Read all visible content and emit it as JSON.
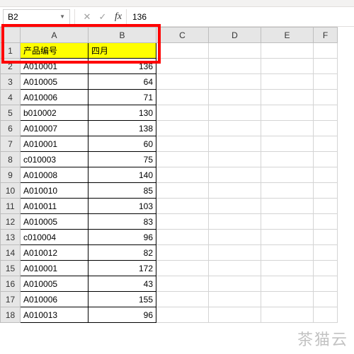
{
  "formula_bar": {
    "name_box": "B2",
    "formula_value": "136"
  },
  "columns": [
    "A",
    "B",
    "C",
    "D",
    "E",
    "F"
  ],
  "headers": {
    "A": "产品编号",
    "B": "四月"
  },
  "rows": [
    {
      "n": 1,
      "a": "产品编号",
      "b": "四月",
      "header": true
    },
    {
      "n": 2,
      "a": "A010001",
      "b": "136"
    },
    {
      "n": 3,
      "a": "A010005",
      "b": "64"
    },
    {
      "n": 4,
      "a": "A010006",
      "b": "71"
    },
    {
      "n": 5,
      "a": "b010002",
      "b": "130"
    },
    {
      "n": 6,
      "a": "A010007",
      "b": "138"
    },
    {
      "n": 7,
      "a": "A010001",
      "b": "60"
    },
    {
      "n": 8,
      "a": "c010003",
      "b": "75"
    },
    {
      "n": 9,
      "a": "A010008",
      "b": "140"
    },
    {
      "n": 10,
      "a": "A010010",
      "b": "85"
    },
    {
      "n": 11,
      "a": "A010011",
      "b": "103"
    },
    {
      "n": 12,
      "a": "A010005",
      "b": "83"
    },
    {
      "n": 13,
      "a": "c010004",
      "b": "96"
    },
    {
      "n": 14,
      "a": "A010012",
      "b": "82"
    },
    {
      "n": 15,
      "a": "A010001",
      "b": "172"
    },
    {
      "n": 16,
      "a": "A010005",
      "b": "43"
    },
    {
      "n": 17,
      "a": "A010006",
      "b": "155"
    },
    {
      "n": 18,
      "a": "A010013",
      "b": "96"
    }
  ],
  "icons": {
    "cancel": "✕",
    "confirm": "✓",
    "fx": "fx",
    "dropdown": "▼"
  },
  "watermark": "茶猫云"
}
